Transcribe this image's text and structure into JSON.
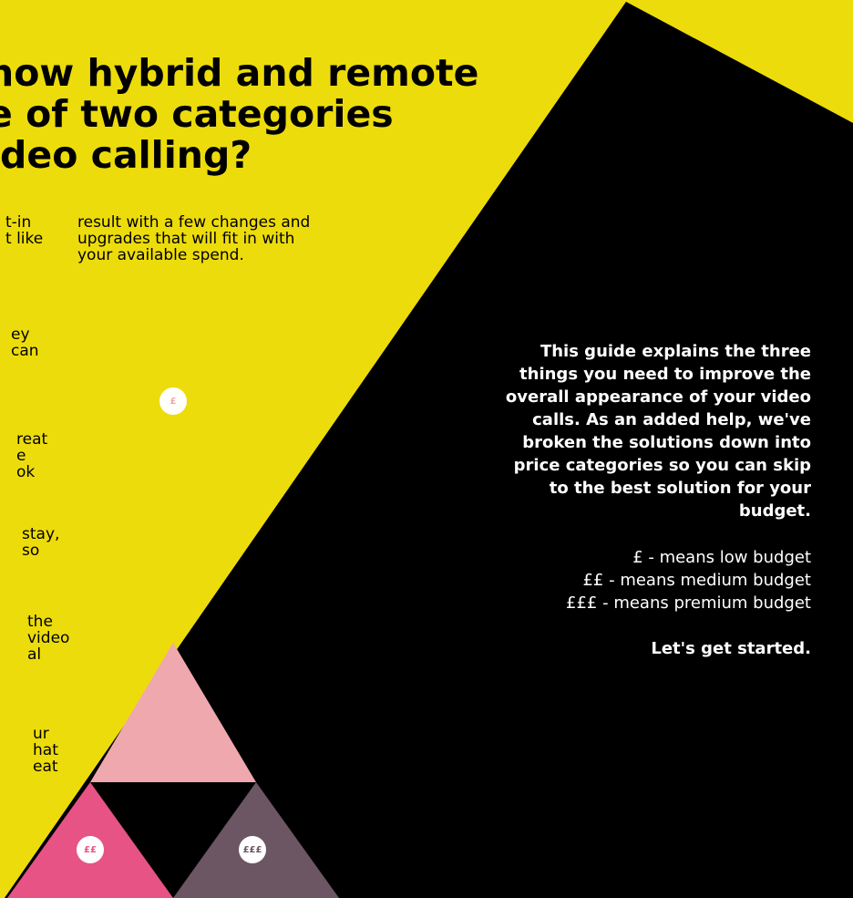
{
  "colors": {
    "yellow": "#EDDC0B",
    "black": "#000000",
    "pink_light": "#EFA8AE",
    "pink_hot": "#E65384",
    "mauve": "#6C5664",
    "white": "#FFFFFF"
  },
  "heading": {
    "lines": [
      "how hybrid and remote",
      "e of two categories",
      "ideo calling?"
    ]
  },
  "left_fragments": [
    [
      "t-in",
      "t like"
    ],
    [
      "ey",
      "can"
    ],
    [
      "reat",
      "e",
      "ok"
    ],
    [
      "stay,",
      "so"
    ],
    [
      "the",
      "video",
      "al"
    ],
    [
      "ur",
      "hat",
      "eat"
    ]
  ],
  "column2": {
    "lines": [
      "result with a few changes and",
      "upgrades that will fit in with",
      "your available spend."
    ]
  },
  "intro": {
    "lines": [
      "This guide explains the three",
      "things you need to improve the",
      "overall appearance of your video",
      "calls. As an added help, we've",
      "broken the solutions down into",
      "price categories so you can skip",
      "to the best solution for your",
      "budget."
    ]
  },
  "legend": [
    "£ - means low budget",
    "££ - means medium budget",
    "£££ - means premium budget"
  ],
  "cta": "Let's get started.",
  "badges": {
    "low": "£",
    "medium": "££",
    "premium": "£££"
  }
}
